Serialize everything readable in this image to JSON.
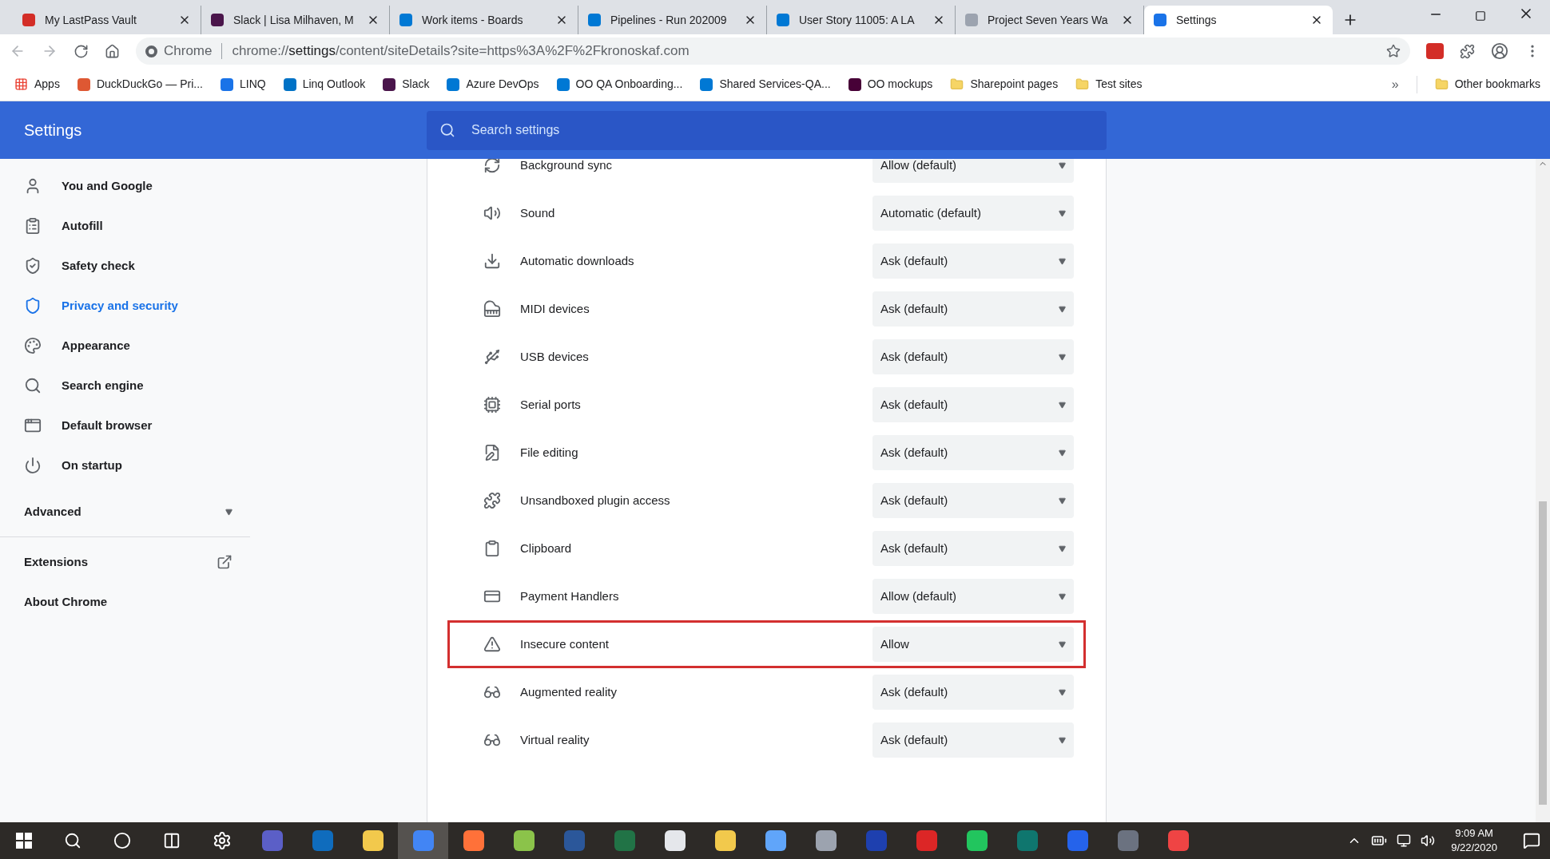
{
  "tabs": [
    {
      "title": "My LastPass Vault",
      "selected": false
    },
    {
      "title": "Slack | Lisa Milhaven, M",
      "selected": false
    },
    {
      "title": "Work items - Boards",
      "selected": false
    },
    {
      "title": "Pipelines - Run 202009",
      "selected": false
    },
    {
      "title": "User Story 11005: A LA",
      "selected": false
    },
    {
      "title": "Project Seven Years Wa",
      "selected": false
    },
    {
      "title": "Settings",
      "selected": true
    }
  ],
  "address": {
    "site_label": "Chrome",
    "scheme": "chrome://",
    "host": "settings",
    "path": "/content/siteDetails?site=https%3A%2F%2Fkronoskaf.com"
  },
  "bookmarks": [
    {
      "label": "Apps"
    },
    {
      "label": "DuckDuckGo — Pri..."
    },
    {
      "label": "LINQ"
    },
    {
      "label": "Linq Outlook"
    },
    {
      "label": "Slack"
    },
    {
      "label": "Azure DevOps"
    },
    {
      "label": "OO QA Onboarding..."
    },
    {
      "label": "Shared Services-QA..."
    },
    {
      "label": "OO mockups"
    },
    {
      "label": "Sharepoint pages"
    },
    {
      "label": "Test sites"
    }
  ],
  "bookmarks_overflow": "»",
  "other_bookmarks": "Other bookmarks",
  "header": {
    "title": "Settings",
    "search_placeholder": "Search settings"
  },
  "sidebar": {
    "items": [
      {
        "label": "You and Google",
        "selected": false
      },
      {
        "label": "Autofill",
        "selected": false
      },
      {
        "label": "Safety check",
        "selected": false
      },
      {
        "label": "Privacy and security",
        "selected": true
      },
      {
        "label": "Appearance",
        "selected": false
      },
      {
        "label": "Search engine",
        "selected": false
      },
      {
        "label": "Default browser",
        "selected": false
      },
      {
        "label": "On startup",
        "selected": false
      }
    ],
    "advanced": {
      "label": "Advanced",
      "expanded": false
    },
    "extensions": "Extensions",
    "about": "About Chrome"
  },
  "permissions": [
    {
      "label": "Background sync",
      "value": "Allow (default)",
      "highlighted": false
    },
    {
      "label": "Sound",
      "value": "Automatic (default)",
      "highlighted": false
    },
    {
      "label": "Automatic downloads",
      "value": "Ask (default)",
      "highlighted": false
    },
    {
      "label": "MIDI devices",
      "value": "Ask (default)",
      "highlighted": false
    },
    {
      "label": "USB devices",
      "value": "Ask (default)",
      "highlighted": false
    },
    {
      "label": "Serial ports",
      "value": "Ask (default)",
      "highlighted": false
    },
    {
      "label": "File editing",
      "value": "Ask (default)",
      "highlighted": false
    },
    {
      "label": "Unsandboxed plugin access",
      "value": "Ask (default)",
      "highlighted": false
    },
    {
      "label": "Clipboard",
      "value": "Ask (default)",
      "highlighted": false
    },
    {
      "label": "Payment Handlers",
      "value": "Allow (default)",
      "highlighted": false
    },
    {
      "label": "Insecure content",
      "value": "Allow",
      "highlighted": true
    },
    {
      "label": "Augmented reality",
      "value": "Ask (default)",
      "highlighted": false
    },
    {
      "label": "Virtual reality",
      "value": "Ask (default)",
      "highlighted": false
    }
  ],
  "taskbar": {
    "apps": [
      {
        "selected": false
      },
      {
        "selected": false
      },
      {
        "selected": false
      },
      {
        "selected": false
      },
      {
        "selected": true
      },
      {
        "selected": false
      },
      {
        "selected": false
      },
      {
        "selected": false
      },
      {
        "selected": false
      },
      {
        "selected": false
      },
      {
        "selected": false
      },
      {
        "selected": false
      },
      {
        "selected": false
      },
      {
        "selected": false
      },
      {
        "selected": false
      },
      {
        "selected": false
      },
      {
        "selected": false
      },
      {
        "selected": false
      },
      {
        "selected": false
      },
      {
        "selected": false
      }
    ],
    "time": "9:09 AM",
    "date": "9/22/2020"
  }
}
